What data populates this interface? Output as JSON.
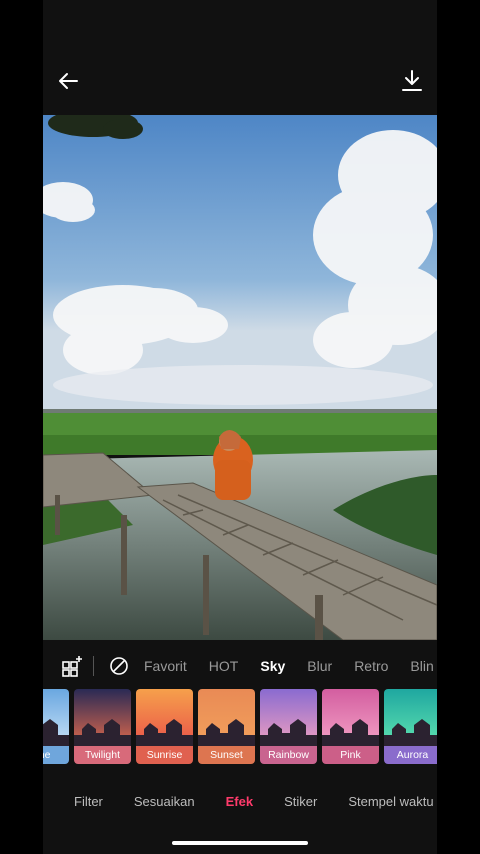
{
  "categories": {
    "items": [
      "Favorit",
      "HOT",
      "Sky",
      "Blur",
      "Retro",
      "Blin"
    ],
    "active": "Sky"
  },
  "sky_presets": [
    {
      "label": "hine",
      "label_color": "#6fa6dc",
      "top": "#6aa7e0",
      "bottom": "#c9e2f7"
    },
    {
      "label": "Twilight",
      "label_color": "#d86a7a",
      "top": "#2a2a55",
      "bottom": "#e06a4c"
    },
    {
      "label": "Sunrise",
      "label_color": "#e0614f",
      "top": "#f6a04b",
      "bottom": "#e9534a"
    },
    {
      "label": "Sunset",
      "label_color": "#dd7550",
      "top": "#e98a55",
      "bottom": "#f2a15c"
    },
    {
      "label": "Rainbow",
      "label_color": "#c9648f",
      "top": "#8a6bd0",
      "bottom": "#f0a0c0"
    },
    {
      "label": "Pink",
      "label_color": "#cc5f88",
      "top": "#d35ea0",
      "bottom": "#f4a2c6"
    },
    {
      "label": "Aurora",
      "label_color": "#8a6ccc",
      "top": "#1fa7a0",
      "bottom": "#5fe3b0"
    }
  ],
  "bottom_tabs": {
    "items": [
      "Filter",
      "Sesuaikan",
      "Efek",
      "Stiker",
      "Stempel waktu"
    ],
    "active": "Efek"
  },
  "colors": {
    "accent": "#ff3b6b",
    "background": "#111111"
  },
  "icons": {
    "back": "arrow-left-icon",
    "download": "download-icon",
    "manage": "grid-plus-icon",
    "none": "no-effect-icon"
  }
}
